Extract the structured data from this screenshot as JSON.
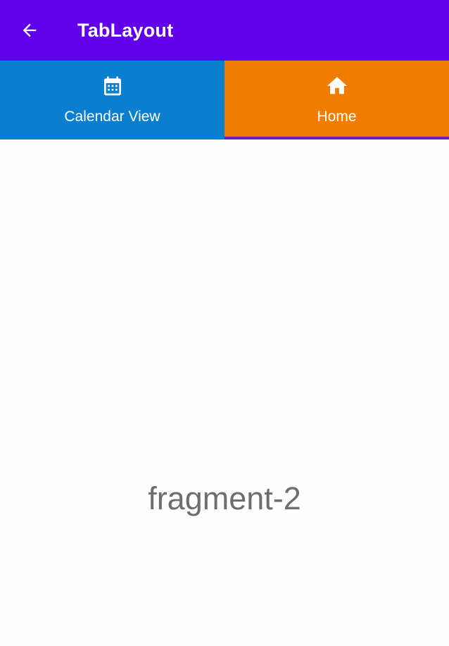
{
  "colors": {
    "toolbar_bg": "#6200ea",
    "tab_calendar_bg": "#0a7fcf",
    "tab_home_bg": "#f27c00",
    "tab_indicator": "#6a1fb8",
    "content_bg": "#fefefe",
    "fragment_text": "#6e6e6e"
  },
  "toolbar": {
    "back_icon": "arrow-back-icon",
    "title": "TabLayout"
  },
  "tabs": [
    {
      "label": "Calendar View",
      "icon": "calendar-icon",
      "selected": false
    },
    {
      "label": "Home",
      "icon": "home-icon",
      "selected": true
    }
  ],
  "content": {
    "text": "fragment-2"
  }
}
